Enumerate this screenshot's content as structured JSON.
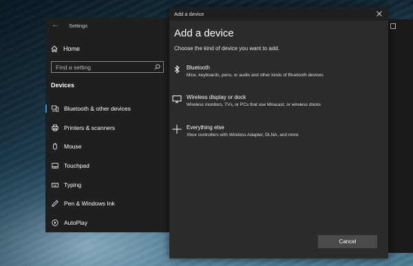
{
  "settings": {
    "window_title": "Settings",
    "home_label": "Home",
    "search_placeholder": "Find a setting",
    "section_heading": "Devices",
    "nav_items": [
      {
        "label": "Bluetooth & other devices",
        "icon": "bluetooth-devices-icon",
        "active": true
      },
      {
        "label": "Printers & scanners",
        "icon": "printer-icon",
        "active": false
      },
      {
        "label": "Mouse",
        "icon": "mouse-icon",
        "active": false
      },
      {
        "label": "Touchpad",
        "icon": "touchpad-icon",
        "active": false
      },
      {
        "label": "Typing",
        "icon": "keyboard-icon",
        "active": false
      },
      {
        "label": "Pen & Windows Ink",
        "icon": "pen-icon",
        "active": false
      },
      {
        "label": "AutoPlay",
        "icon": "autoplay-icon",
        "active": false
      }
    ]
  },
  "dialog": {
    "window_title": "Add a device",
    "heading": "Add a device",
    "subtitle": "Choose the kind of device you want to add.",
    "options": [
      {
        "name": "Bluetooth",
        "description": "Mice, keyboards, pens, or audio and other kinds of Bluetooth devices",
        "icon": "bluetooth-icon"
      },
      {
        "name": "Wireless display or dock",
        "description": "Wireless monitors, TVs, or PCs that use Miracast, or wireless docks",
        "icon": "monitor-icon"
      },
      {
        "name": "Everything else",
        "description": "Xbox controllers with Wireless Adapter, DLNA, and more",
        "icon": "plus-icon"
      }
    ],
    "cancel_label": "Cancel"
  },
  "colors": {
    "accent": "#3a8fd9",
    "window_bg": "#1f1f1f",
    "dialog_bg": "#2b2b2b",
    "button_bg": "#4a4a4a"
  }
}
